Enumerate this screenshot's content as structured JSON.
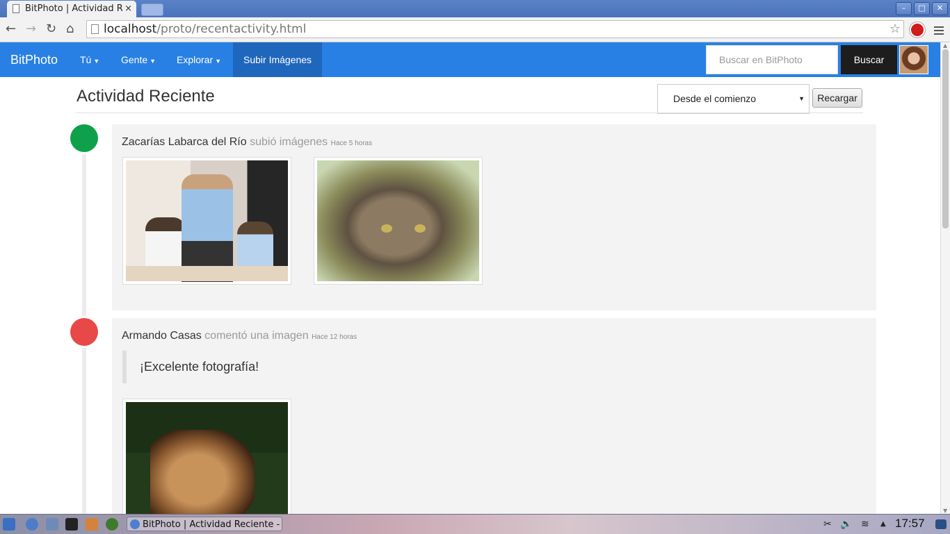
{
  "browser": {
    "tab_title": "BitPhoto | Actividad Re",
    "tab_close": "×",
    "url_host": "localhost",
    "url_path": "/proto/recentactivity.html"
  },
  "navbar": {
    "brand": "BitPhoto",
    "items": [
      {
        "label": "Tú"
      },
      {
        "label": "Gente"
      },
      {
        "label": "Explorar"
      },
      {
        "label": "Subir Imágenes"
      }
    ],
    "search_placeholder": "Buscar en BitPhoto",
    "search_button": "Buscar"
  },
  "page": {
    "title": "Actividad Reciente",
    "filter_value": "Desde el comienzo",
    "reload_label": "Recargar"
  },
  "activities": [
    {
      "user": "Zacarías Labarca del Río",
      "action": "subió imágenes",
      "time": "Hace 5 horas",
      "dot_color": "#0fa14a",
      "images": [
        "office-photo",
        "cat-photo"
      ]
    },
    {
      "user": "Armando Casas",
      "action": "comentó una imagen",
      "time": "Hace 12 horas",
      "dot_color": "#e94848",
      "comment": "¡Excelente fotografía!",
      "images": [
        "horse-photo"
      ]
    }
  ],
  "taskbar": {
    "task_label": "BitPhoto | Actividad Reciente -",
    "clock": "17:57"
  }
}
